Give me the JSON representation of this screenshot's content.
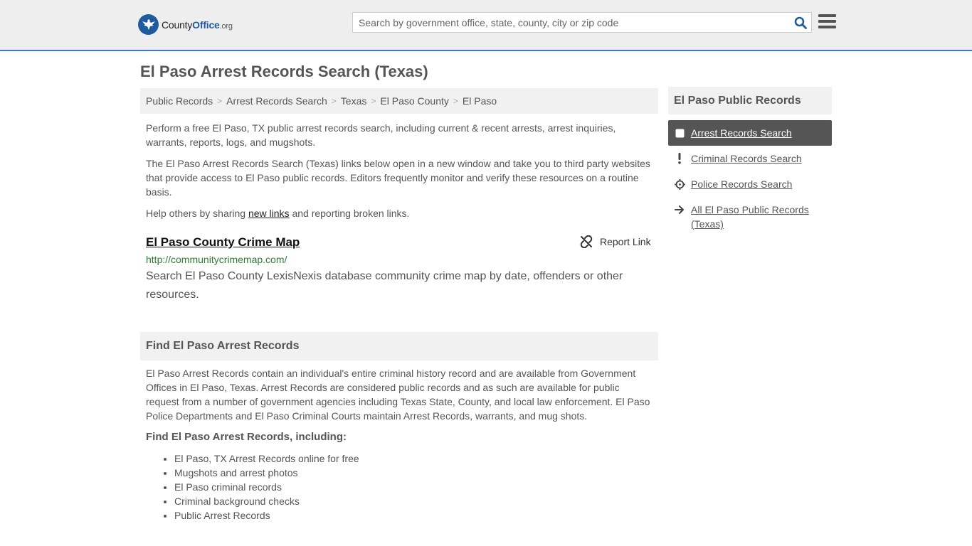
{
  "header": {
    "logo": {
      "county": "County",
      "office": "Office",
      "org": ".org"
    },
    "search_placeholder": "Search by government office, state, county, city or zip code"
  },
  "page": {
    "title": "El Paso Arrest Records Search (Texas)"
  },
  "breadcrumb": [
    "Public Records",
    "Arrest Records Search",
    "Texas",
    "El Paso County",
    "El Paso"
  ],
  "intro": {
    "p1": "Perform a free El Paso, TX public arrest records search, including current & recent arrests, arrest inquiries, warrants, reports, logs, and mugshots.",
    "p2": "The El Paso Arrest Records Search (Texas) links below open in a new window and take you to third party websites that provide access to El Paso public records. Editors frequently monitor and verify these resources on a routine basis.",
    "p3_before": "Help others by sharing ",
    "p3_link": "new links",
    "p3_after": " and reporting broken links."
  },
  "resource": {
    "title": "El Paso County Crime Map",
    "report_label": "Report Link",
    "url": "http://communitycrimemap.com/",
    "description": "Search El Paso County LexisNexis database community crime map by date, offenders or other resources."
  },
  "find_section": {
    "heading": "Find El Paso Arrest Records",
    "paragraph": "El Paso Arrest Records contain an individual's entire criminal history record and are available from Government Offices in El Paso, Texas. Arrest Records are considered public records and as such are available for public request from a number of government agencies including Texas State, County, and local law enforcement. El Paso Police Departments and El Paso Criminal Courts maintain Arrest Records, warrants, and mug shots.",
    "subheading": "Find El Paso Arrest Records, including:",
    "items": [
      "El Paso, TX Arrest Records online for free",
      "Mugshots and arrest photos",
      "El Paso criminal records",
      "Criminal background checks",
      "Public Arrest Records"
    ]
  },
  "sidebar": {
    "heading": "El Paso Public Records",
    "items": [
      {
        "label": "Arrest Records Search",
        "icon": "square-icon"
      },
      {
        "label": "Criminal Records Search",
        "icon": "exclamation-icon"
      },
      {
        "label": "Police Records Search",
        "icon": "crosshair-icon"
      },
      {
        "label": "All El Paso Public Records (Texas)",
        "icon": "arrow-right-icon"
      }
    ]
  },
  "colors": {
    "accent": "#3c7bc0",
    "logo_blue": "#1f5b9c",
    "url_green": "#2e7d32",
    "active_bg": "#555555"
  }
}
